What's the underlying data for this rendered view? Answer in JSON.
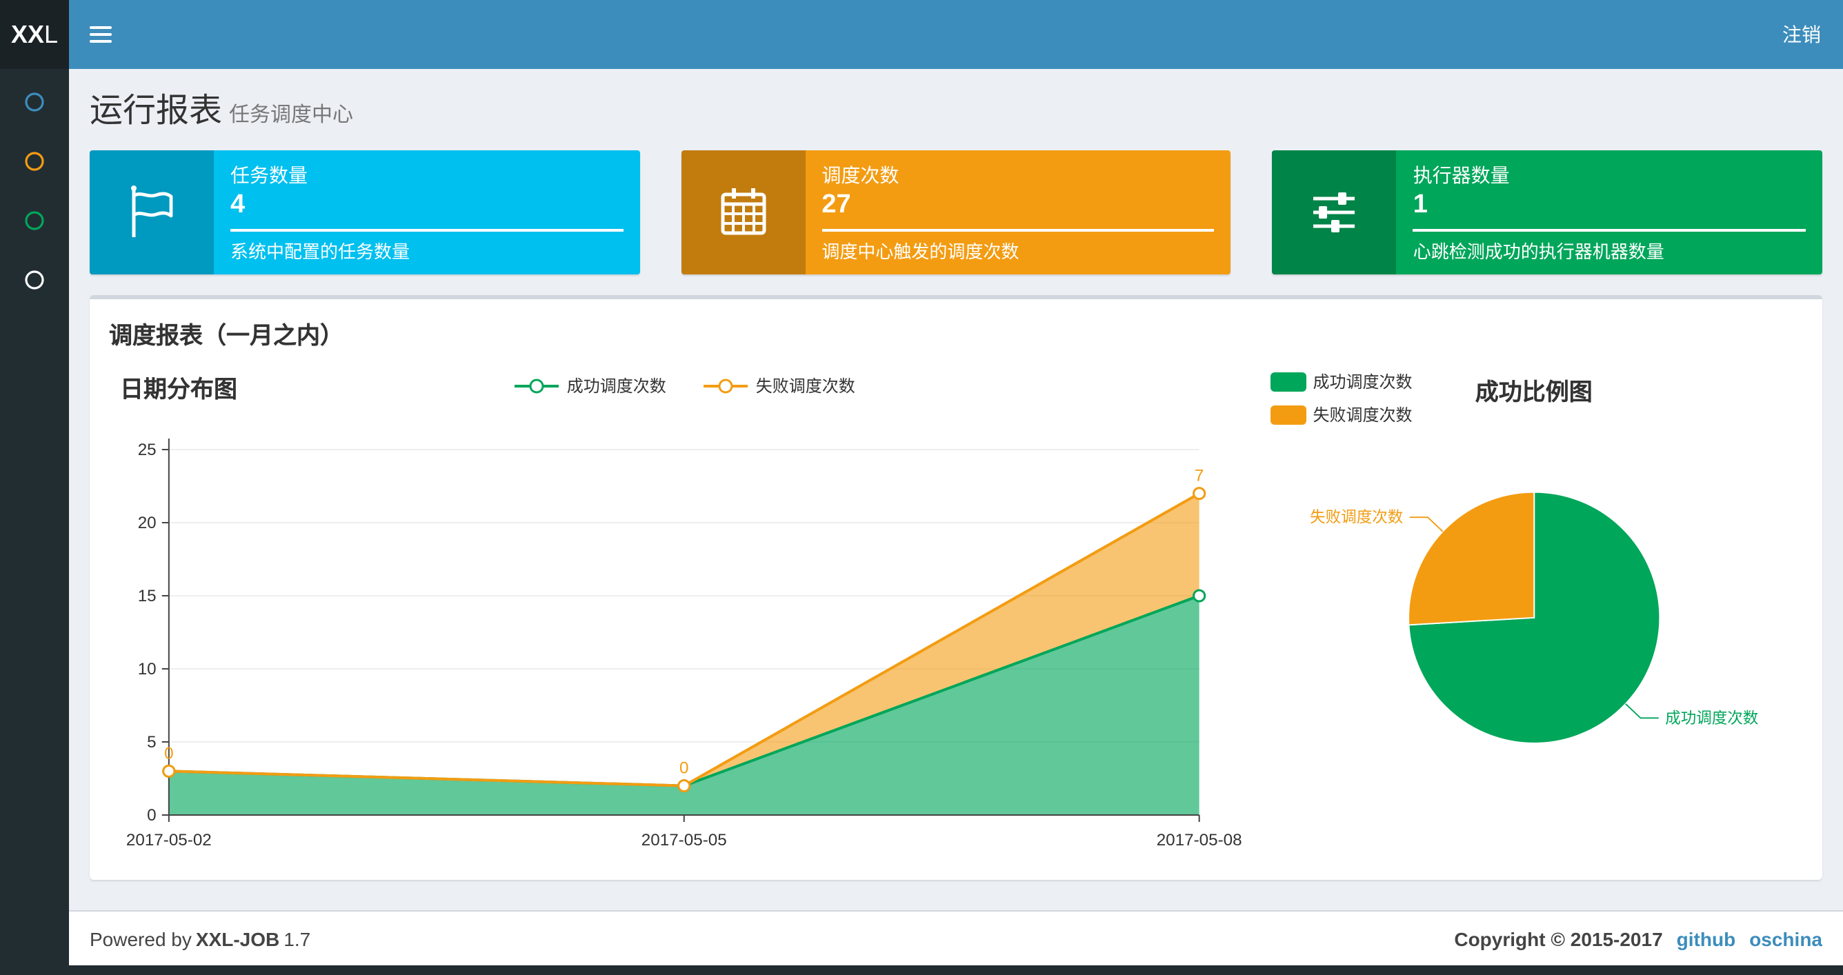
{
  "navbar": {
    "logo_bold": "XX",
    "logo_light": "L",
    "logout_label": "注销"
  },
  "sidebar": {
    "items": [
      {
        "icon": "circle-outline-icon",
        "color": "#3c8dbc"
      },
      {
        "icon": "circle-outline-icon",
        "color": "#f39c12"
      },
      {
        "icon": "circle-outline-icon",
        "color": "#00a65a"
      },
      {
        "icon": "circle-outline-icon",
        "color": "#ffffff"
      }
    ]
  },
  "page_header": {
    "title": "运行报表",
    "subtitle": "任务调度中心"
  },
  "info_boxes": [
    {
      "icon": "flag-icon",
      "label": "任务数量",
      "value": "4",
      "description": "系统中配置的任务数量",
      "color": "#00c0ef"
    },
    {
      "icon": "calendar-icon",
      "label": "调度次数",
      "value": "27",
      "description": "调度中心触发的调度次数",
      "color": "#f39c12"
    },
    {
      "icon": "sliders-icon",
      "label": "执行器数量",
      "value": "1",
      "description": "心跳检测成功的执行器机器数量",
      "color": "#00a65a"
    }
  ],
  "panel": {
    "title": "调度报表（一月之内）"
  },
  "chart_data": [
    {
      "type": "area",
      "title": "日期分布图",
      "x": [
        "2017-05-02",
        "2017-05-05",
        "2017-05-08"
      ],
      "series": [
        {
          "name": "成功调度次数",
          "values": [
            3,
            2,
            15
          ],
          "color": "#00a65a"
        },
        {
          "name": "失败调度次数",
          "values": [
            0,
            0,
            7
          ],
          "color": "#f39c12"
        }
      ],
      "stacked": true,
      "point_labels_series": "失败调度次数",
      "point_labels": [
        0,
        0,
        7
      ],
      "ylim": [
        0,
        25
      ],
      "yticks": [
        0,
        5,
        10,
        15,
        20,
        25
      ],
      "legend_position": "top-center",
      "grid": false
    },
    {
      "type": "pie",
      "title": "成功比例图",
      "slices": [
        {
          "name": "成功调度次数",
          "value": 20,
          "color": "#00a65a"
        },
        {
          "name": "失败调度次数",
          "value": 7,
          "color": "#f39c12"
        }
      ],
      "start_angle": "top",
      "direction": "clockwise",
      "legend_position": "top-left"
    }
  ],
  "footer": {
    "powered_prefix": "Powered by",
    "product": "XXL-JOB",
    "version": "1.7",
    "copyright": "Copyright © 2015-2017",
    "links": [
      {
        "label": "github"
      },
      {
        "label": "oschina"
      }
    ]
  }
}
